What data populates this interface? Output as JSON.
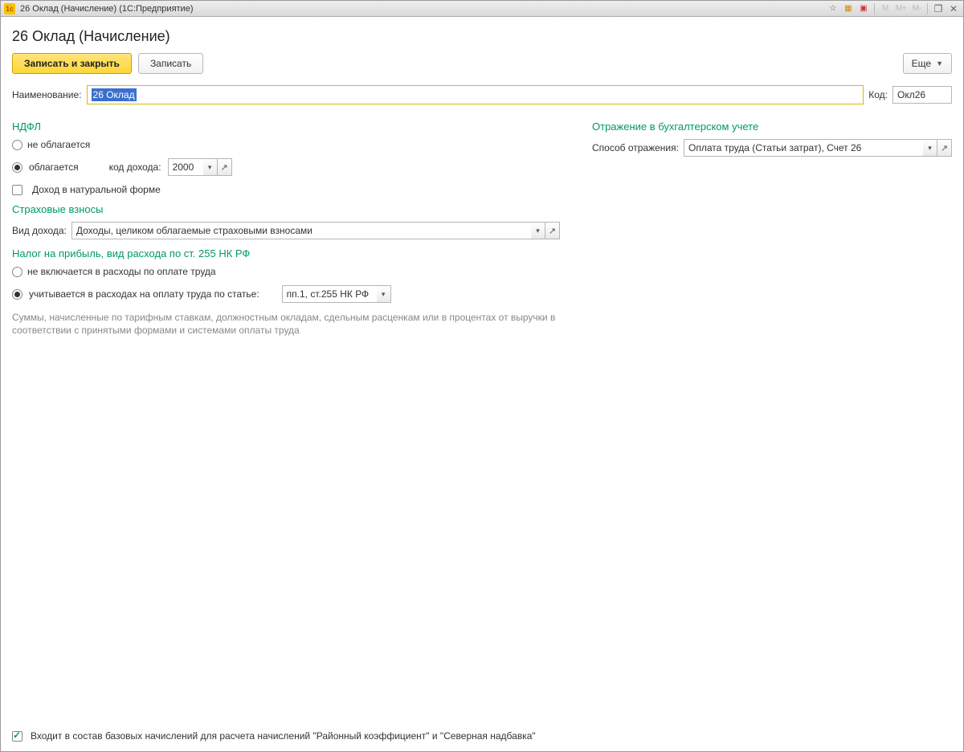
{
  "titlebar": {
    "title": "26 Оклад (Начисление)  (1С:Предприятие)",
    "mem_labels": [
      "M",
      "M+",
      "M-"
    ]
  },
  "page": {
    "title": "26 Оклад (Начисление)"
  },
  "toolbar": {
    "save_close": "Записать и закрыть",
    "save": "Записать",
    "more": "Еще"
  },
  "fields": {
    "name_label": "Наименование:",
    "name_value": "26 Оклад",
    "code_label": "Код:",
    "code_value": "Окл26"
  },
  "ndfl": {
    "header": "НДФЛ",
    "not_taxed": "не облагается",
    "taxed": "облагается",
    "taxed_selected": true,
    "income_code_label": "код дохода:",
    "income_code_value": "2000",
    "natural_income": "Доход в натуральной форме",
    "natural_income_checked": false
  },
  "insurance": {
    "header": "Страховые взносы",
    "income_type_label": "Вид дохода:",
    "income_type_value": "Доходы, целиком облагаемые страховыми взносами"
  },
  "profit_tax": {
    "header": "Налог на прибыль, вид расхода по ст. 255 НК РФ",
    "not_included": "не включается в расходы по оплате труда",
    "included": "учитывается в расходах на оплату труда по статье:",
    "included_selected": true,
    "article_value": "пп.1, ст.255 НК РФ",
    "hint": "Суммы, начисленные по тарифным ставкам, должностным окладам, сдельным расценкам или в процентах от выручки в соответствии с принятыми формами и системами оплаты труда"
  },
  "accounting": {
    "header": "Отражение в бухгалтерском учете",
    "method_label": "Способ отражения:",
    "method_value": "Оплата труда (Статьи затрат), Счет 26"
  },
  "footer": {
    "base_accrual_checked": true,
    "base_accrual_label": "Входит в состав базовых начислений для расчета начислений \"Районный коэффициент\" и \"Северная надбавка\""
  }
}
